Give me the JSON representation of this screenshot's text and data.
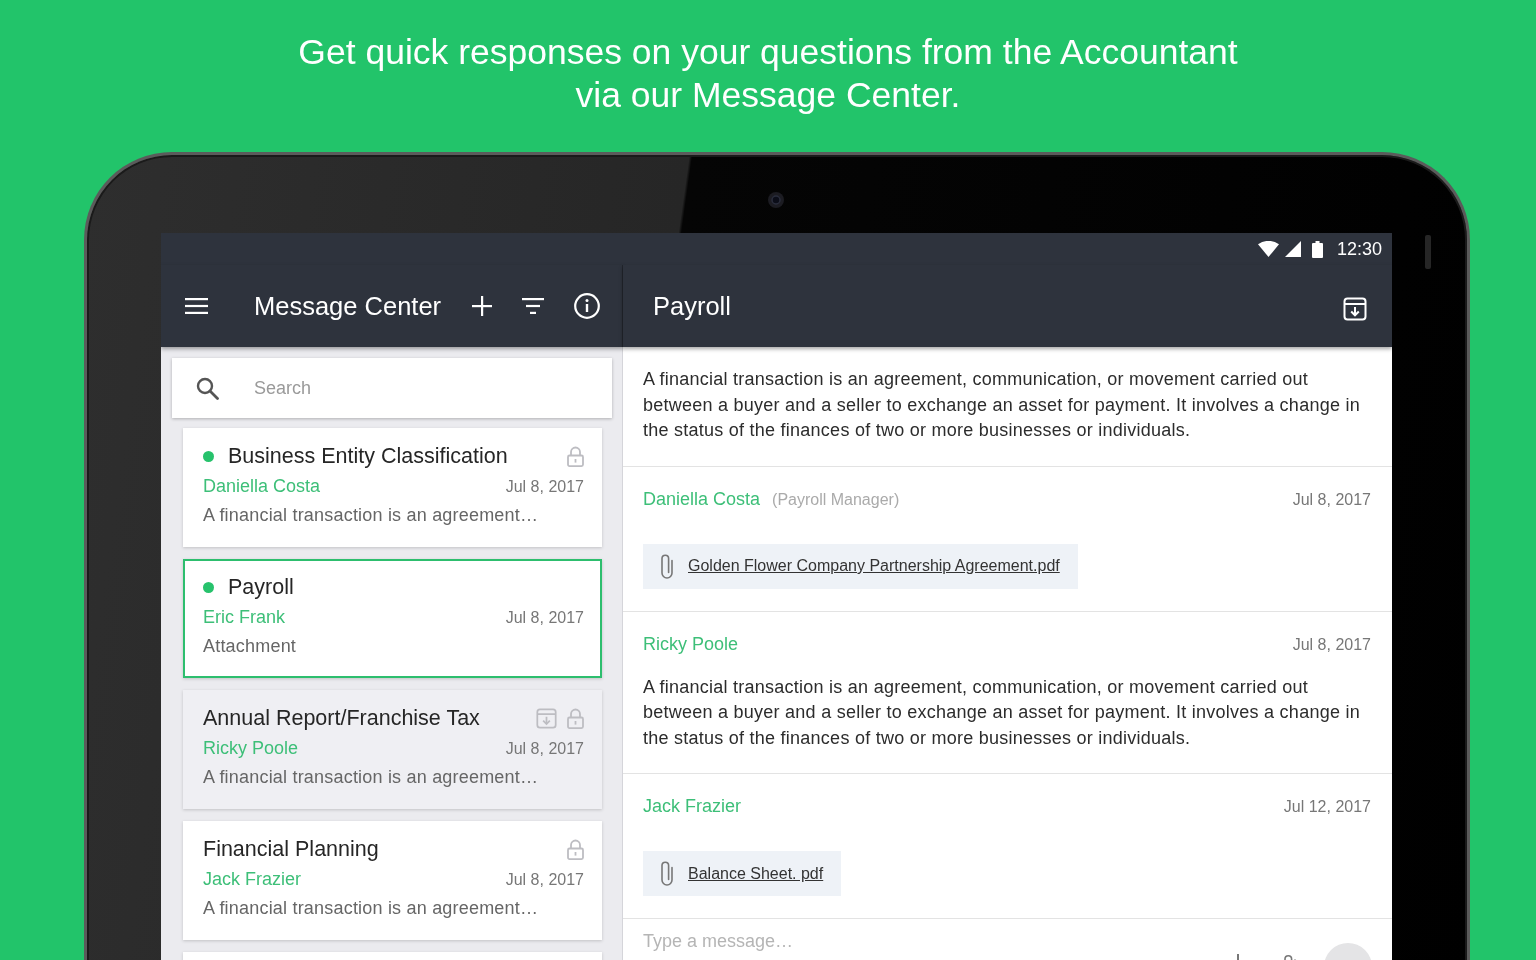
{
  "headline": "Get quick responses on your questions from the Accountant\nvia our Message Center.",
  "status_bar": {
    "time": "12:30"
  },
  "sidebar": {
    "title": "Message Center",
    "search": {
      "placeholder": "Search"
    },
    "conversations": [
      {
        "title": "Business Entity Classification",
        "sender": "Daniella Costa",
        "date": "Jul 8, 2017",
        "preview": "A financial transaction is an agreement…",
        "unread": true,
        "selected": false,
        "locked": true,
        "archived": false
      },
      {
        "title": "Payroll",
        "sender": "Eric Frank",
        "date": "Jul 8, 2017",
        "preview": "Attachment",
        "unread": true,
        "selected": true,
        "locked": false,
        "archived": false
      },
      {
        "title": "Annual Report/Franchise Tax",
        "sender": "Ricky Poole",
        "date": "Jul 8, 2017",
        "preview": "A financial transaction is an agreement…",
        "unread": false,
        "selected": false,
        "locked": true,
        "archived": true
      },
      {
        "title": "Financial Planning",
        "sender": "Jack Frazier",
        "date": "Jul 8, 2017",
        "preview": "A financial transaction is an agreement…",
        "unread": false,
        "selected": false,
        "locked": true,
        "archived": false
      }
    ]
  },
  "thread": {
    "title": "Payroll",
    "messages": [
      {
        "body": "A financial transaction is an agreement, communication, or movement carried out between a buyer and a seller to exchange an asset for payment. It involves a change in the status of the finances of two or more businesses or individuals."
      },
      {
        "sender": "Daniella Costa",
        "role": "(Payroll Manager)",
        "date": "Jul 8, 2017",
        "attachment": "Golden Flower Company Partnership Agreement.pdf"
      },
      {
        "sender": "Ricky Poole",
        "date": "Jul 8, 2017",
        "body": "A financial transaction is an agreement, communication, or movement carried out between a buyer and a seller to exchange an asset for payment. It involves a change in the status of the finances of two or more businesses or individuals."
      },
      {
        "sender": "Jack Frazier",
        "date": "Jul 12, 2017",
        "attachment": "Balance Sheet. pdf"
      }
    ],
    "composer": {
      "placeholder": "Type a message…"
    }
  }
}
